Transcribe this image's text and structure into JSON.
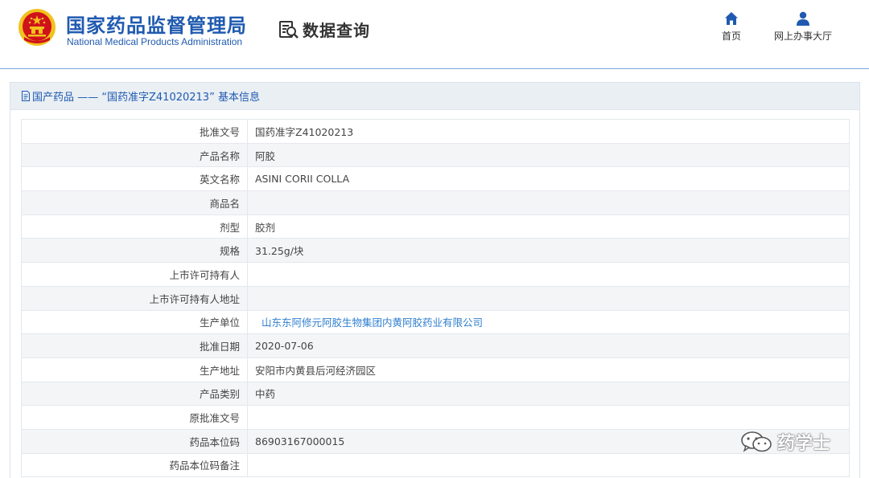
{
  "header": {
    "org_name_cn": "国家药品监督管理局",
    "org_name_en": "National Medical Products Administration",
    "query_label": "数据查询",
    "nav": [
      {
        "label": "首页",
        "icon": "home-icon"
      },
      {
        "label": "网上办事大厅",
        "icon": "user-icon"
      }
    ]
  },
  "panel": {
    "title": "国产药品 —— “国药准字Z41020213” 基本信息"
  },
  "details": [
    {
      "key": "批准文号",
      "value": "国药准字Z41020213"
    },
    {
      "key": "产品名称",
      "value": "阿胶"
    },
    {
      "key": "英文名称",
      "value": "ASINI CORII COLLA"
    },
    {
      "key": "商品名",
      "value": ""
    },
    {
      "key": "剂型",
      "value": "胶剂"
    },
    {
      "key": "规格",
      "value": "31.25g/块"
    },
    {
      "key": "上市许可持有人",
      "value": ""
    },
    {
      "key": "上市许可持有人地址",
      "value": ""
    },
    {
      "key": "生产单位",
      "value": "山东东阿修元阿胶生物集团内黄阿胶药业有限公司"
    },
    {
      "key": "批准日期",
      "value": "2020-07-06"
    },
    {
      "key": "生产地址",
      "value": "安阳市内黄县后河经济园区"
    },
    {
      "key": "产品类别",
      "value": "中药"
    },
    {
      "key": "原批准文号",
      "value": ""
    },
    {
      "key": "药品本位码",
      "value": "86903167000015"
    },
    {
      "key": "药品本位码备注",
      "value": ""
    }
  ],
  "watermark": {
    "text": "药学士",
    "icon": "wechat-icon"
  },
  "colors": {
    "brand": "#1f5ab0",
    "link": "#2f7fd0",
    "emblem_red": "#d0121b",
    "emblem_gold": "#f2c21d"
  }
}
